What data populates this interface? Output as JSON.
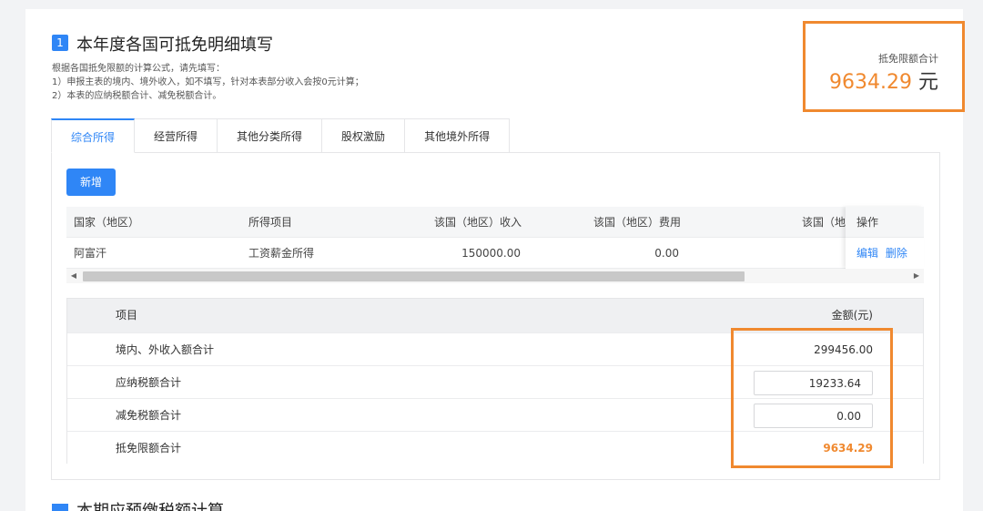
{
  "section": {
    "number": "1",
    "title": "本年度各国可抵免明细填写",
    "desc_lines": [
      "根据各国抵免限额的计算公式，请先填写：",
      "1）申报主表的境内、境外收入，如不填写，针对本表部分收入会按0元计算；",
      "2）本表的应纳税额合计、减免税额合计。"
    ]
  },
  "limit": {
    "label": "抵免限额合计",
    "value": "9634.29",
    "unit": "元"
  },
  "tabs": [
    "综合所得",
    "经营所得",
    "其他分类所得",
    "股权激励",
    "其他境外所得"
  ],
  "add_button": "新增",
  "grid": {
    "headers": [
      "国家（地区）",
      "所得项目",
      "该国（地区）收入",
      "该国（地区）费用",
      "该国（地"
    ],
    "op_header": "操作",
    "rows": [
      {
        "country": "阿富汗",
        "item": "工资薪金所得",
        "income": "150000.00",
        "cost": "0.00"
      }
    ],
    "edit_label": "编辑",
    "delete_label": "删除"
  },
  "summary": {
    "col_item": "项目",
    "col_amount": "金额(元)",
    "rows": {
      "total_income": {
        "label": "境内、外收入额合计",
        "value": "299456.00"
      },
      "tax_payable": {
        "label": "应纳税额合计",
        "value": "19233.64"
      },
      "tax_reduction": {
        "label": "减免税额合计",
        "value": "0.00"
      },
      "credit_limit": {
        "label": "抵免限额合计",
        "value": "9634.29"
      }
    }
  },
  "colors": {
    "accent": "#2f86f6",
    "highlight": "#f0892f"
  },
  "next_section_title": "本期应预缴税额计算"
}
